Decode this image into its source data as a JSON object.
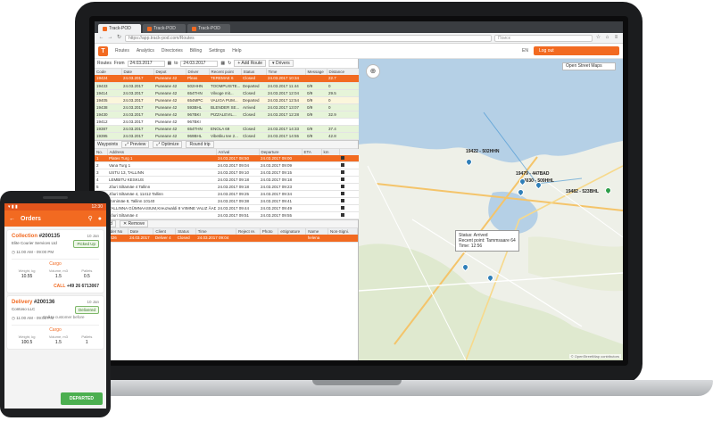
{
  "browser": {
    "tabs": [
      {
        "label": "Track-POD"
      },
      {
        "label": "Track-POD"
      },
      {
        "label": "Track-POD"
      }
    ],
    "url": "https://app.track-pod.com/Routes",
    "search_placeholder": "Поиск"
  },
  "app": {
    "logo_letter": "T",
    "menu": [
      "Routes",
      "Analytics",
      "Directories",
      "Billing",
      "Settings",
      "Help"
    ],
    "language": "EN",
    "logout_label": "Log out"
  },
  "routes_filter": {
    "title": "Routes",
    "from_label": "From",
    "from_date": "24.03.2017",
    "to_label": "to",
    "to_date": "24.03.2017",
    "add_route_label": "Add Route",
    "drivers_label": "Drivers"
  },
  "routes_table": {
    "headers": [
      "Code",
      "Date",
      "Depot",
      "Driver",
      "Recent point",
      "Status",
      "Time",
      "Message",
      "Distance"
    ],
    "rows": [
      {
        "style": "sel",
        "cells": [
          "19424",
          "24.03.2017",
          "Puneane 42",
          "Pleas",
          "TEREMAE 6",
          "Closed",
          "24.03.2017 10:34",
          "",
          "22.7"
        ]
      },
      {
        "style": "green",
        "cells": [
          "19433",
          "24.03.2017",
          "Puneane 42",
          "502HHN",
          "TOOMPUISTE...",
          "Departed",
          "24.03.2017 11:44",
          "0/9",
          "0"
        ]
      },
      {
        "style": "green",
        "cells": [
          "19414",
          "24.03.2017",
          "Puneane 42",
          "654THN",
          "Vilvoge mit...",
          "Closed",
          "24.03.2017 12:04",
          "0/9",
          "29.5"
        ]
      },
      {
        "style": "yellow",
        "cells": [
          "19405",
          "24.03.2017",
          "Puneane 42",
          "654MPC",
          "VALIGA PUM...",
          "Departed",
          "24.03.2017 12:54",
          "0/9",
          "0"
        ]
      },
      {
        "style": "green",
        "cells": [
          "19438",
          "24.03.2017",
          "Puneane 42",
          "593BHL",
          "BLENDER SE...",
          "Arrived",
          "24.03.2017 13:07",
          "0/9",
          "0"
        ]
      },
      {
        "style": "green",
        "cells": [
          "19430",
          "24.03.2017",
          "Puneane 42",
          "967BKI",
          "PIZZALEVIL...",
          "Closed",
          "24.03.2017 12:28",
          "0/9",
          "32.9"
        ]
      },
      {
        "style": "white",
        "cells": [
          "19412",
          "24.03.2017",
          "Puneane 42",
          "967BKI",
          "",
          "",
          "",
          "",
          ""
        ]
      },
      {
        "style": "green",
        "cells": [
          "19387",
          "24.03.2017",
          "Puneane 42",
          "654THN",
          "ENOLA 69",
          "Closed",
          "24.03.2017 14:33",
          "0/9",
          "37.4"
        ]
      },
      {
        "style": "green",
        "cells": [
          "19395",
          "24.03.2017",
          "Puneane 42",
          "969BHL",
          "Vibetiku tee 2...",
          "Closed",
          "24.03.2017 14:55",
          "0/9",
          "42.8"
        ]
      }
    ]
  },
  "waypoints": {
    "title": "Waypoints",
    "preview_label": "Preview",
    "optimize_label": "Optimize",
    "round_trip_label": "Round trip",
    "headers": [
      "No.",
      "Address",
      "Arrival",
      "Departure",
      "ETA",
      "km"
    ],
    "rows": [
      {
        "style": "sel",
        "cells": [
          "1",
          "Plates Turg 1",
          "24.03.2017 08:50",
          "24.03.2017 09:00",
          "",
          ""
        ]
      },
      {
        "style": "white",
        "cells": [
          "2",
          "Vana Turg 1",
          "24.03.2017 09:04",
          "24.03.2017 09:09",
          "",
          ""
        ]
      },
      {
        "style": "white",
        "cells": [
          "3",
          "USTU 13, TALLINN",
          "24.03.2017 09:10",
          "24.03.2017 09:15",
          "",
          ""
        ]
      },
      {
        "style": "white",
        "cells": [
          "4",
          "LEMBITU KESKUS",
          "24.03.2017 09:18",
          "24.03.2017 09:18",
          "",
          ""
        ]
      },
      {
        "style": "white",
        "cells": [
          "5",
          "Jõuri Siltamäe 4 Tallinn",
          "24.03.2017 09:18",
          "24.03.2017 09:23",
          "",
          ""
        ]
      },
      {
        "style": "white",
        "cells": [
          "6",
          "Jõuri Siltamäe 4, 11412 Tallinn",
          "24.03.2017 09:25",
          "24.03.2017 09:34",
          "",
          ""
        ]
      },
      {
        "style": "white",
        "cells": [
          "7",
          "Tornimäe 8, Tallinn 10140",
          "24.03.2017 09:38",
          "24.03.2017 09:41",
          "",
          ""
        ]
      },
      {
        "style": "white",
        "cells": [
          "8",
          "TALLINNA GÜMNAASIUM,Kreuzwaldi 8 VIIMNE VALIZ ÄADRESS",
          "24.03.2017 09:44",
          "24.03.2017 09:49",
          "",
          ""
        ]
      },
      {
        "style": "white",
        "cells": [
          "9",
          "Jõuri Siltamäe 4",
          "24.03.2017 09:51",
          "24.03.2017 09:55",
          "",
          ""
        ]
      }
    ]
  },
  "orders_panel": {
    "add_label": "Add",
    "remove_label": "Remove",
    "headers": [
      "",
      "Order No",
      "Date",
      "Client",
      "Status",
      "Time",
      "Reject re.",
      "Photo",
      "eSignature",
      "Name",
      "Non-Signi."
    ],
    "rows": [
      {
        "style": "sel",
        "cells": [
          "",
          "19426",
          "24.03.2017",
          "Deliver 4",
          "Closed",
          "24.03.2017 09:04",
          "",
          "",
          "",
          "helena",
          ""
        ]
      }
    ]
  },
  "map": {
    "layer_select": "Open Street Maps",
    "zoom_symbol": "⊕",
    "labels": [
      {
        "text": "19422 - 502HHN"
      },
      {
        "text": "19479 - 447BAD"
      },
      {
        "text": "14030 - 509HHL"
      },
      {
        "text": "19482 - 523BHL"
      }
    ],
    "tooltip": {
      "status": "Status: Arrived",
      "recent": "Recent point: Tammsaare 64",
      "time": "Time: 12:56"
    },
    "attribution": "© OpenStreetMap contributors"
  },
  "phone": {
    "status_time": "12:30",
    "status_icons": "▾ ▮ ▮",
    "toolbar_title": "Orders",
    "cards": [
      {
        "kind": "Collection",
        "number": "#200135",
        "date": "10 Jan",
        "client": "Elite Courier Services Ltd",
        "badge": "Picked Up",
        "time": "11:00 AM - 09:00 PM",
        "section": "Cargo",
        "cargo_labels": [
          "Weight, kg",
          "Volume, m3",
          "Pallets"
        ],
        "cargo_values": [
          "10.55",
          "1.5",
          "0.5"
        ],
        "call_label": "CALL",
        "phone": "+49 26 6713067"
      },
      {
        "kind": "Delivery",
        "number": "#200136",
        "date": "10 Jan",
        "client": "Contoso LLC",
        "badge": "Delivered",
        "time": "11:00 AM - 09:00 PM",
        "note": "Call to customer before",
        "section": "Cargo",
        "cargo_labels": [
          "Weight, kg",
          "Volume, m3",
          "Pallets"
        ],
        "cargo_values": [
          "100.5",
          "1.5",
          "1"
        ]
      }
    ],
    "action_label": "DEPARTED"
  }
}
